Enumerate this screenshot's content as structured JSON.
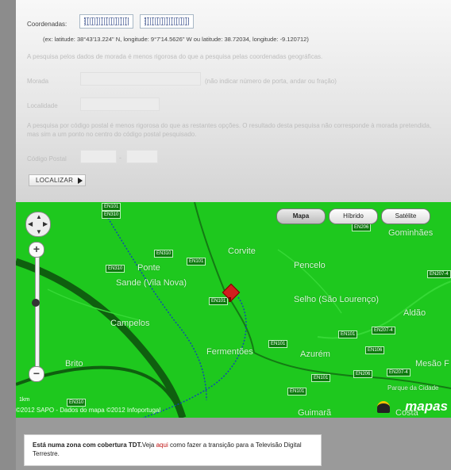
{
  "form": {
    "coords_label": "Coordenadas:",
    "coords_example": "(ex: latitude: 38°43'13.224\" N, longitude: 9°7'14.5626\" W ou latitude: 38.72034, longitude: -9.120712)",
    "address_note": "A pesquisa pelos dados de morada é menos rigorosa do que a pesquisa pelas coordenadas geográficas.",
    "morada_label": "Morada",
    "morada_hint": "(não indicar número de porta, andar ou fração)",
    "localidade_label": "Localidade",
    "postal_note": "A pesquisa por código postal é menos rigorosa do que as restantes opções. O resultado desta pesquisa não corresponde à morada pretendida, mas sim a um ponto no centro do código postal pesquisado.",
    "codigo_postal_label": "Código Postal",
    "postal_separator": "-",
    "localizar_label": "LOCALIZAR"
  },
  "map": {
    "buttons": [
      "Mapa",
      "Híbrido",
      "Satélite"
    ],
    "active_button": "Mapa",
    "places": [
      "Gominhães",
      "Corvite",
      "Pencelo",
      "Ponte",
      "Sande (Vila Nova)",
      "Selho (São Lourenço)",
      "Aldão",
      "Campelos",
      "Fermentões",
      "Azurém",
      "Brito",
      "Mesão F",
      "Parque da Cidade",
      "Guimarã",
      "Costa"
    ],
    "roads": [
      "EN101",
      "EN310",
      "EN310",
      "EN101",
      "EN206",
      "EN310",
      "EN101",
      "EN101",
      "EN101",
      "EN206",
      "EN207-4",
      "EN207-4",
      "EN101",
      "EN101",
      "EN106",
      "EN207-4",
      "EN310"
    ],
    "scale": "1km",
    "copyright": "©2012 SAPO - Dados do mapa ©2012 Infoportugal",
    "logo_text": "mapas"
  },
  "tdt_notice": {
    "bold_text": "Está numa zona com cobertura TDT.",
    "pre_link": "Veja ",
    "link_text": "aqui",
    "post_link": " como fazer a transição para a Televisão Digital Terrestre."
  },
  "colors": {
    "map_green": "#1ec81e",
    "road_dark": "#0e7a0e",
    "marker_red": "#d21e1e",
    "link_red": "#c01212"
  }
}
